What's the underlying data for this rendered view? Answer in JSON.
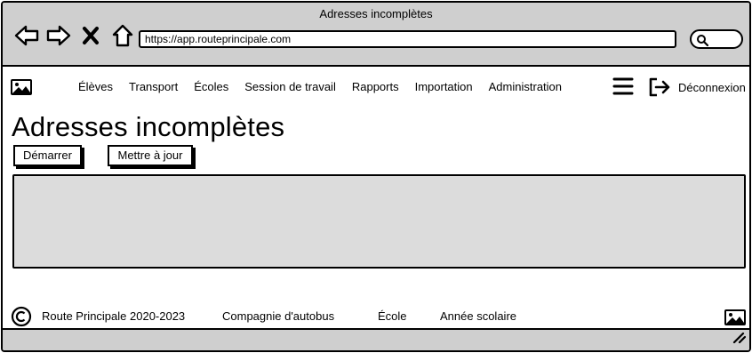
{
  "window": {
    "title": "Adresses incomplètes"
  },
  "browser": {
    "url": "https://app.routeprincipale.com",
    "nav_icons": [
      "back-arrow-icon",
      "forward-arrow-icon",
      "close-x-icon",
      "home-icon"
    ],
    "search_icon": "search-icon"
  },
  "header": {
    "nav": [
      "Élèves",
      "Transport",
      "Écoles",
      "Session de travail",
      "Rapports",
      "Importation",
      "Administration"
    ],
    "logout_label": "Déconnexion"
  },
  "main": {
    "title": "Adresses incomplètes",
    "start_label": "Démarrer",
    "update_label": "Mettre à jour"
  },
  "footer": {
    "copyright": "Route Principale 2020-2023",
    "bus_company": "Compagnie d'autobus",
    "school": "École",
    "school_year": "Année scolaire"
  },
  "colors": {
    "chrome": "#cfcfcf",
    "panel": "#dcdcdc",
    "ink": "#000000"
  }
}
